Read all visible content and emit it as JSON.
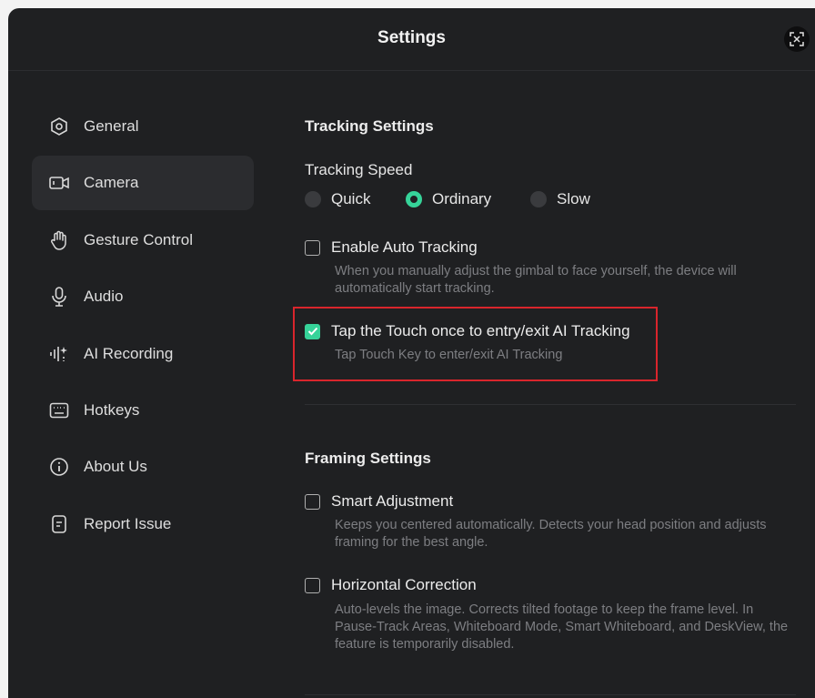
{
  "window": {
    "title": "Settings"
  },
  "sidebar": {
    "items": [
      {
        "label": "General",
        "icon": "hexagon-settings-icon",
        "active": false
      },
      {
        "label": "Camera",
        "icon": "camera-icon",
        "active": true
      },
      {
        "label": "Gesture Control",
        "icon": "hand-icon",
        "active": false
      },
      {
        "label": "Audio",
        "icon": "microphone-icon",
        "active": false
      },
      {
        "label": "AI Recording",
        "icon": "ai-recording-icon",
        "active": false
      },
      {
        "label": "Hotkeys",
        "icon": "keyboard-icon",
        "active": false
      },
      {
        "label": "About Us",
        "icon": "info-icon",
        "active": false
      },
      {
        "label": "Report Issue",
        "icon": "document-icon",
        "active": false
      }
    ]
  },
  "tracking": {
    "section_title": "Tracking Settings",
    "speed_label": "Tracking Speed",
    "speed_options": [
      "Quick",
      "Ordinary",
      "Slow"
    ],
    "speed_selected": "Ordinary",
    "auto_tracking": {
      "label": "Enable Auto Tracking",
      "description": "When you manually adjust the gimbal to face yourself, the device will automatically start tracking.",
      "checked": false
    },
    "tap_touch": {
      "label": "Tap the Touch once to entry/exit AI Tracking",
      "description": "Tap Touch Key to enter/exit AI Tracking",
      "checked": true
    }
  },
  "framing": {
    "section_title": "Framing Settings",
    "smart_adjustment": {
      "label": "Smart Adjustment",
      "description": "Keeps you centered automatically. Detects your head position and adjusts framing for the best angle.",
      "checked": false
    },
    "horizontal_correction": {
      "label": "Horizontal Correction",
      "description": "Auto-levels the image. Corrects tilted footage to keep the frame level. In Pause-Track Areas, Whiteboard Mode, Smart Whiteboard, and DeskView, the feature is temporarily disabled.",
      "checked": false
    }
  },
  "colors": {
    "accent": "#36d399",
    "highlight_border": "#d9252c",
    "background": "#1f2022"
  }
}
